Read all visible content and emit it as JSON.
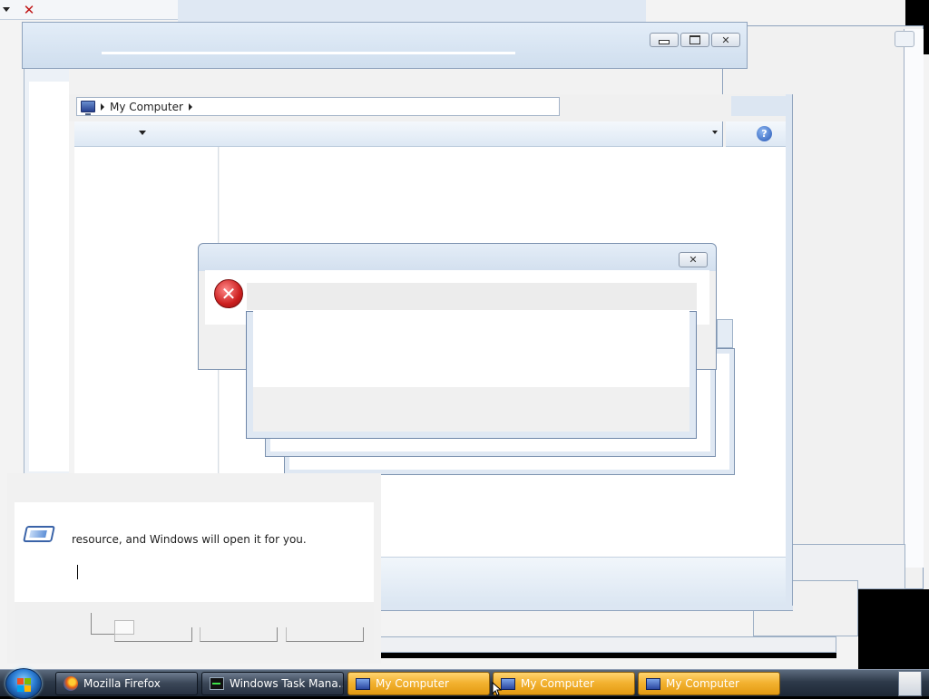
{
  "colors": {
    "taskbar_active": "#f2b12f",
    "taskbar_dark": "#2e3a4a",
    "error_red": "#cc1f1f",
    "window_frame": "#d6e2f0"
  },
  "explorer": {
    "address_segments": [
      "My Computer"
    ],
    "help_icon": "question-icon",
    "organize_dropdown_icon": "chevron-down-icon"
  },
  "run_dialog": {
    "description_fragment": "resource, and Windows will open it for you.",
    "input_value": "",
    "icon": "run-icon"
  },
  "error_dialog": {
    "icon": "error-x-icon",
    "close_icon": "close-icon"
  },
  "topleft": {
    "menu_icon": "chevron-down-icon",
    "close_icon": "close-icon"
  },
  "taskbar": {
    "start_icon": "windows-logo-icon",
    "items": [
      {
        "label": "Mozilla Firefox",
        "icon": "firefox-icon",
        "active": false
      },
      {
        "label": "Windows Task Mana...",
        "icon": "task-manager-icon",
        "active": false
      },
      {
        "label": "My Computer",
        "icon": "computer-icon",
        "active": true
      },
      {
        "label": "My Computer",
        "icon": "computer-icon",
        "active": true
      },
      {
        "label": "My Computer",
        "icon": "computer-icon",
        "active": true
      }
    ]
  }
}
